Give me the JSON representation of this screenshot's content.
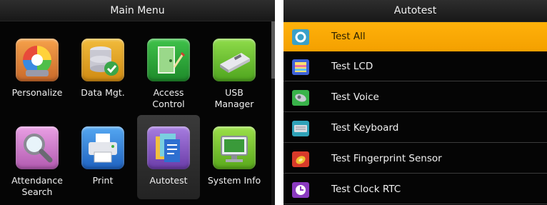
{
  "main_menu": {
    "title": "Main Menu",
    "items": [
      {
        "label_lines": [
          "Personalize"
        ],
        "icon": "color-wheel-icon",
        "selected": false
      },
      {
        "label_lines": [
          "Data Mgt."
        ],
        "icon": "database-check-icon",
        "selected": false
      },
      {
        "label_lines": [
          "Access",
          "Control"
        ],
        "icon": "door-icon",
        "selected": false
      },
      {
        "label_lines": [
          "USB",
          "Manager"
        ],
        "icon": "usb-drive-icon",
        "selected": false
      },
      {
        "label_lines": [
          "Attendance",
          "Search"
        ],
        "icon": "magnifier-icon",
        "selected": false
      },
      {
        "label_lines": [
          "Print"
        ],
        "icon": "printer-icon",
        "selected": false
      },
      {
        "label_lines": [
          "Autotest"
        ],
        "icon": "autotest-icon",
        "selected": true
      },
      {
        "label_lines": [
          "System Info"
        ],
        "icon": "monitor-icon",
        "selected": false
      }
    ]
  },
  "autotest": {
    "title": "Autotest",
    "items": [
      {
        "label": "Test All",
        "icon": "test-all-icon",
        "active": true
      },
      {
        "label": "Test LCD",
        "icon": "lcd-icon",
        "active": false
      },
      {
        "label": "Test Voice",
        "icon": "speaker-icon",
        "active": false
      },
      {
        "label": "Test Keyboard",
        "icon": "keyboard-icon",
        "active": false
      },
      {
        "label": "Test Fingerprint Sensor",
        "icon": "fingerprint-icon",
        "active": false
      },
      {
        "label": "Test Clock RTC",
        "icon": "clock-icon",
        "active": false
      }
    ]
  },
  "colors": {
    "background": "#050505",
    "highlight": "#f7a800",
    "text": "#f0f0f0"
  }
}
